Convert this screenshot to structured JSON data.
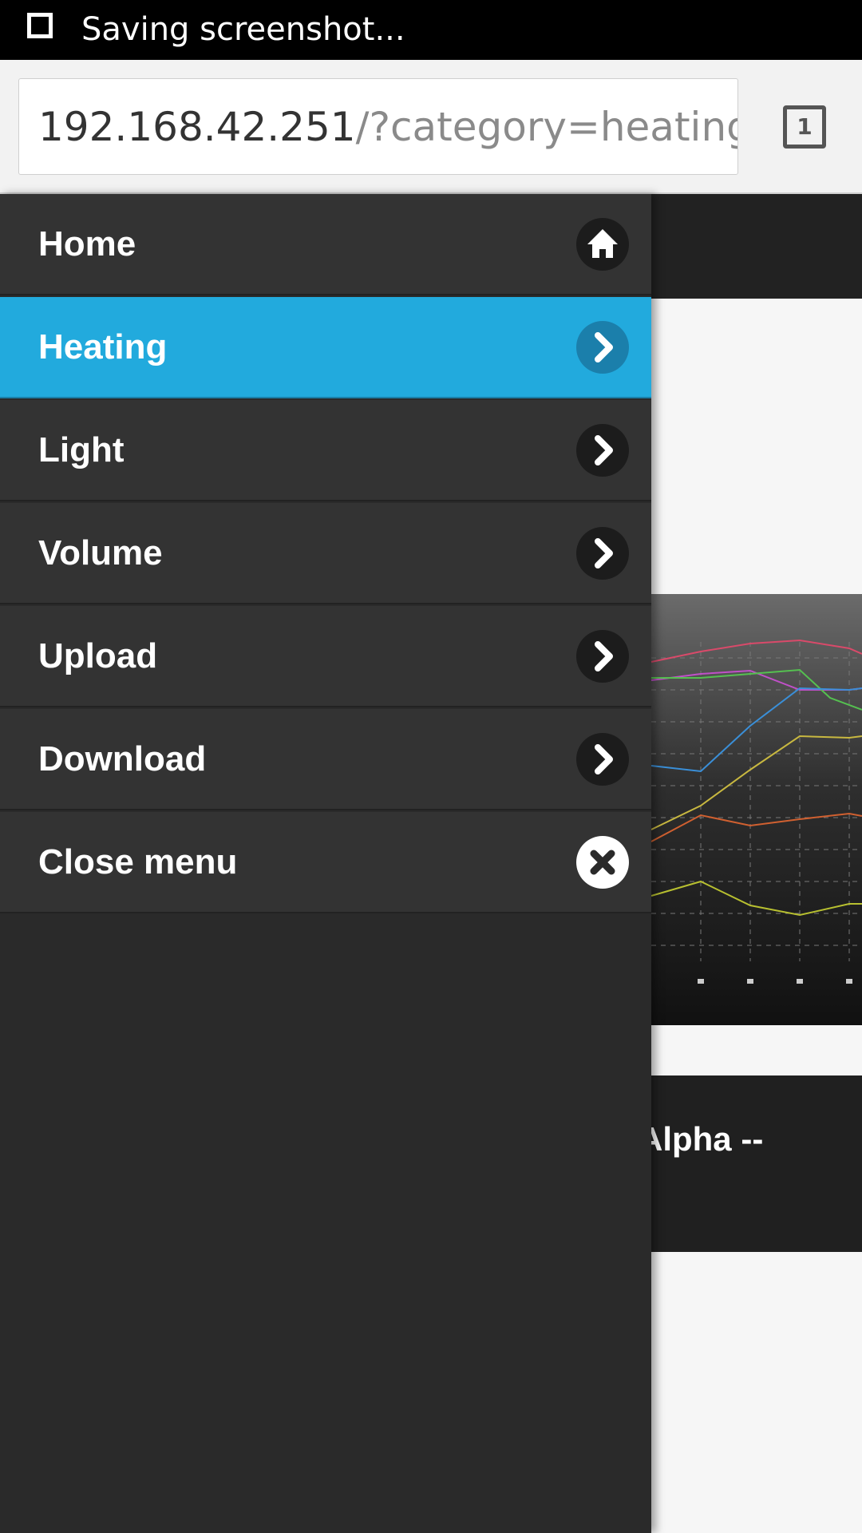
{
  "status_bar": {
    "text": "Saving screenshot..."
  },
  "browser": {
    "url_host": "192.168.42.251",
    "url_path": "/?category=heating",
    "tab_count": "1"
  },
  "menu": {
    "items": [
      {
        "label": "Home",
        "icon": "home-icon",
        "active": false
      },
      {
        "label": "Heating",
        "icon": "chevron-right-icon",
        "active": true
      },
      {
        "label": "Light",
        "icon": "chevron-right-icon",
        "active": false
      },
      {
        "label": "Volume",
        "icon": "chevron-right-icon",
        "active": false
      },
      {
        "label": "Upload",
        "icon": "chevron-right-icon",
        "active": false
      },
      {
        "label": "Download",
        "icon": "chevron-right-icon",
        "active": false
      },
      {
        "label": "Close menu",
        "icon": "close-icon",
        "active": false
      }
    ]
  },
  "background": {
    "card_title": "Alpha --"
  },
  "colors": {
    "accent": "#22aadd",
    "drawer_bg": "#2a2a2a",
    "menu_item_bg": "#333333"
  }
}
